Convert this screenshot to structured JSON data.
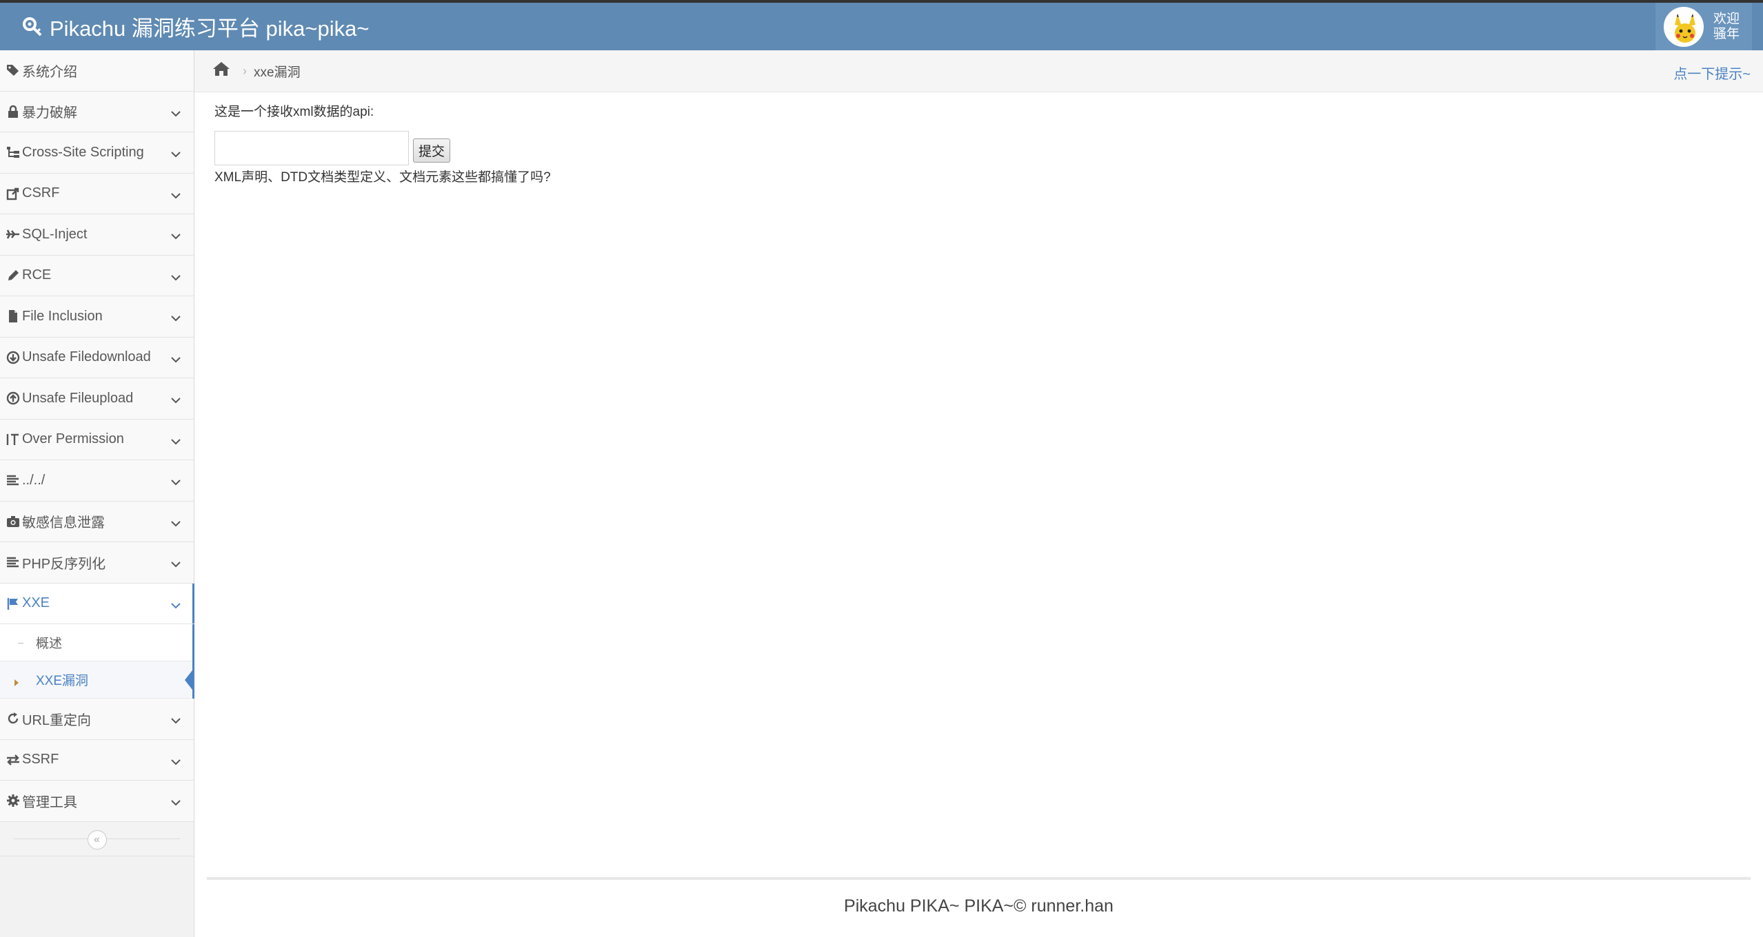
{
  "header": {
    "brand": "Pikachu 漏洞练习平台 pika~pika~",
    "user_line1": "欢迎",
    "user_line2": "骚年"
  },
  "sidebar": {
    "items": [
      {
        "label": "系统介绍",
        "icon": "tags-icon",
        "has_chevron": false
      },
      {
        "label": "暴力破解",
        "icon": "lock-icon",
        "has_chevron": true
      },
      {
        "label": "Cross-Site Scripting",
        "icon": "sitemap-icon",
        "has_chevron": true
      },
      {
        "label": "CSRF",
        "icon": "share-icon",
        "has_chevron": true
      },
      {
        "label": "SQL-Inject",
        "icon": "fighter-jet-icon",
        "has_chevron": true
      },
      {
        "label": "RCE",
        "icon": "pencil-icon",
        "has_chevron": true
      },
      {
        "label": "File Inclusion",
        "icon": "file-icon",
        "has_chevron": true
      },
      {
        "label": "Unsafe Filedownload",
        "icon": "download-circle-icon",
        "has_chevron": true
      },
      {
        "label": "Unsafe Fileupload",
        "icon": "upload-circle-icon",
        "has_chevron": true
      },
      {
        "label": "Over Permission",
        "icon": "text-height-icon",
        "has_chevron": true
      },
      {
        "label": "../../",
        "icon": "align-left-icon",
        "has_chevron": true
      },
      {
        "label": "敏感信息泄露",
        "icon": "camera-icon",
        "has_chevron": true
      },
      {
        "label": "PHP反序列化",
        "icon": "align-left-icon",
        "has_chevron": true
      },
      {
        "label": "XXE",
        "icon": "flag-icon",
        "has_chevron": true,
        "active": true
      },
      {
        "label": "URL重定向",
        "icon": "refresh-icon",
        "has_chevron": true
      },
      {
        "label": "SSRF",
        "icon": "exchange-icon",
        "has_chevron": true
      },
      {
        "label": "管理工具",
        "icon": "gear-icon",
        "has_chevron": true
      }
    ],
    "xxe_sub": [
      {
        "label": "概述"
      },
      {
        "label": "XXE漏洞",
        "active": true
      }
    ]
  },
  "breadcrumb": {
    "current": "xxe漏洞"
  },
  "hint_link": "点一下提示~",
  "content": {
    "description": "这是一个接收xml数据的api:",
    "input_value": "",
    "submit_label": "提交",
    "tip": "XML声明、DTD文档类型定义、文档元素这些都搞懂了吗?"
  },
  "footer": "Pikachu PIKA~ PIKA~© runner.han",
  "colors": {
    "navbar": "#5f8ab3",
    "accent": "#4b82c3"
  }
}
